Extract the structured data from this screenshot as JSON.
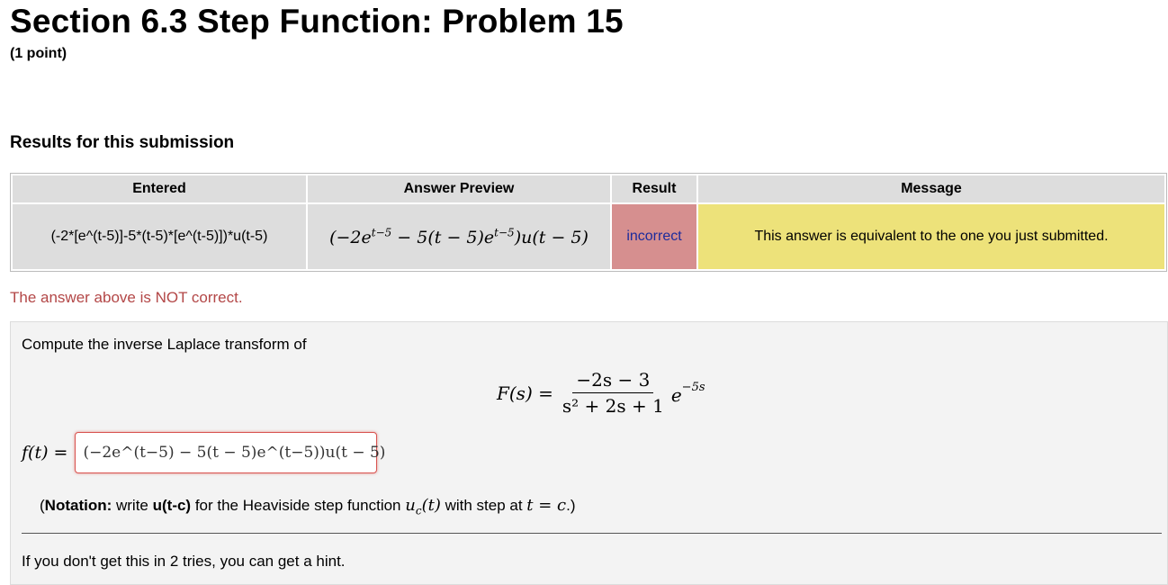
{
  "page": {
    "title": "Section 6.3 Step Function: Problem 15",
    "points": "(1 point)"
  },
  "results": {
    "heading": "Results for this submission",
    "columns": [
      "Entered",
      "Answer Preview",
      "Result",
      "Message"
    ],
    "row": {
      "entered": "(-2*[e^(t-5)]-5*(t-5)*[e^(t-5)])*u(t-5)",
      "preview": "(−2e^(t−5) − 5(t − 5)e^(t−5))u(t − 5)",
      "result": "incorrect",
      "message": "This answer is equivalent to the one you just submitted."
    },
    "colors": {
      "header_bg": "#dddddd",
      "incorrect_bg": "#d68f8f",
      "message_bg": "#ede27a"
    }
  },
  "status_message": "The answer above is NOT correct.",
  "problem": {
    "intro": "Compute the inverse Laplace transform of",
    "equation": {
      "lhs": "F(s) =",
      "numerator": "−2s − 3",
      "denominator": "s² + 2s + 1",
      "exp_base": "e",
      "exp_power": "−5s"
    },
    "answer_label": "f(t) =",
    "answer_value": "(−2e^(t−5) − 5(t − 5)e^(t−5))u(t − 5)",
    "notation": {
      "prefix": "(",
      "bold1": "Notation:",
      "text1": " write ",
      "bold2": "u(t-c)",
      "text2": " for the Heaviside step function ",
      "math1": "u",
      "math1_sub": "c",
      "math1_rest": "(t)",
      "text3": " with step at ",
      "math2": "t = c",
      "suffix": ".)"
    },
    "hint": "If you don't get this in 2 tries, you can get a hint."
  }
}
